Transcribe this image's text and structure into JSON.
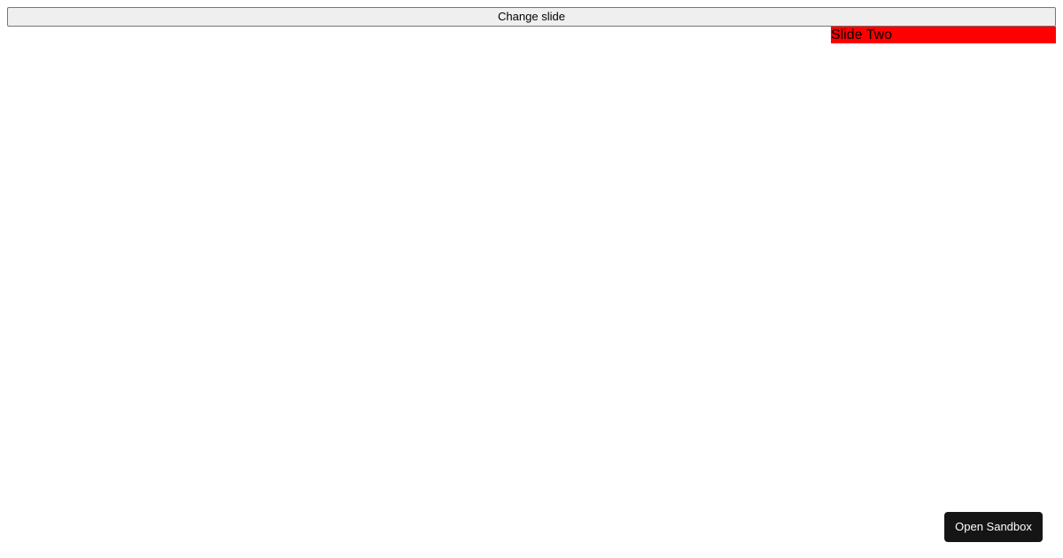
{
  "controls": {
    "change_slide_label": "Change slide"
  },
  "slideshow": {
    "current_slide_label": "Slide Two",
    "slide_background": "#ff0000"
  },
  "footer": {
    "open_sandbox_label": "Open Sandbox"
  }
}
